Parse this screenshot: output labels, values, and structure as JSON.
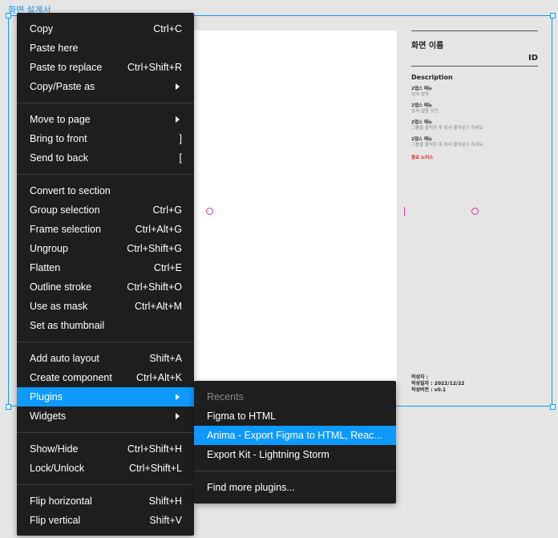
{
  "canvas": {
    "frame_label": "화면 설계서"
  },
  "spec_panel": {
    "title": "화면 이름",
    "id_label": "ID",
    "description_heading": "Description",
    "items": [
      {
        "heading": "2뎁스 메뉴",
        "sub": "상세 설명"
      },
      {
        "heading": "2뎁스 메뉴",
        "sub": "상세 설명 상단"
      },
      {
        "heading": "2뎁스 메뉴",
        "sub": "그룹을 클릭한 후 복사 붙여넣기 하세요"
      },
      {
        "heading": "2뎁스 메뉴",
        "sub": "그룹을 클릭한 후 복사 붙여넣기 하세요"
      }
    ],
    "notice": "중요 노티스",
    "author": "작성자 :",
    "date": "작성일자 : 2022/12/22",
    "version": "작성버전 : v0.1"
  },
  "context_menu": {
    "groups": [
      [
        {
          "label": "Copy",
          "shortcut": "Ctrl+C"
        },
        {
          "label": "Paste here",
          "shortcut": ""
        },
        {
          "label": "Paste to replace",
          "shortcut": "Ctrl+Shift+R"
        },
        {
          "label": "Copy/Paste as",
          "shortcut": "",
          "submenu": true
        }
      ],
      [
        {
          "label": "Move to page",
          "shortcut": "",
          "submenu": true
        },
        {
          "label": "Bring to front",
          "shortcut": "]"
        },
        {
          "label": "Send to back",
          "shortcut": "["
        }
      ],
      [
        {
          "label": "Convert to section",
          "shortcut": ""
        },
        {
          "label": "Group selection",
          "shortcut": "Ctrl+G"
        },
        {
          "label": "Frame selection",
          "shortcut": "Ctrl+Alt+G"
        },
        {
          "label": "Ungroup",
          "shortcut": "Ctrl+Shift+G"
        },
        {
          "label": "Flatten",
          "shortcut": "Ctrl+E"
        },
        {
          "label": "Outline stroke",
          "shortcut": "Ctrl+Shift+O"
        },
        {
          "label": "Use as mask",
          "shortcut": "Ctrl+Alt+M"
        },
        {
          "label": "Set as thumbnail",
          "shortcut": ""
        }
      ],
      [
        {
          "label": "Add auto layout",
          "shortcut": "Shift+A"
        },
        {
          "label": "Create component",
          "shortcut": "Ctrl+Alt+K"
        },
        {
          "label": "Plugins",
          "shortcut": "",
          "submenu": true,
          "highlighted": true
        },
        {
          "label": "Widgets",
          "shortcut": "",
          "submenu": true
        }
      ],
      [
        {
          "label": "Show/Hide",
          "shortcut": "Ctrl+Shift+H"
        },
        {
          "label": "Lock/Unlock",
          "shortcut": "Ctrl+Shift+L"
        }
      ],
      [
        {
          "label": "Flip horizontal",
          "shortcut": "Shift+H"
        },
        {
          "label": "Flip vertical",
          "shortcut": "Shift+V"
        }
      ]
    ]
  },
  "plugins_submenu": {
    "caption": "Recents",
    "items": [
      {
        "label": "Figma to HTML"
      },
      {
        "label": "Anima - Export Figma to HTML, Reac...",
        "highlighted": true
      },
      {
        "label": "Export Kit - Lightning Storm"
      }
    ],
    "more": "Find more plugins..."
  },
  "colors": {
    "accent": "#0d99ff",
    "menu_bg": "#1e1e1e",
    "ruler_pink": "#e0309a",
    "notice_red": "#e0211f"
  }
}
